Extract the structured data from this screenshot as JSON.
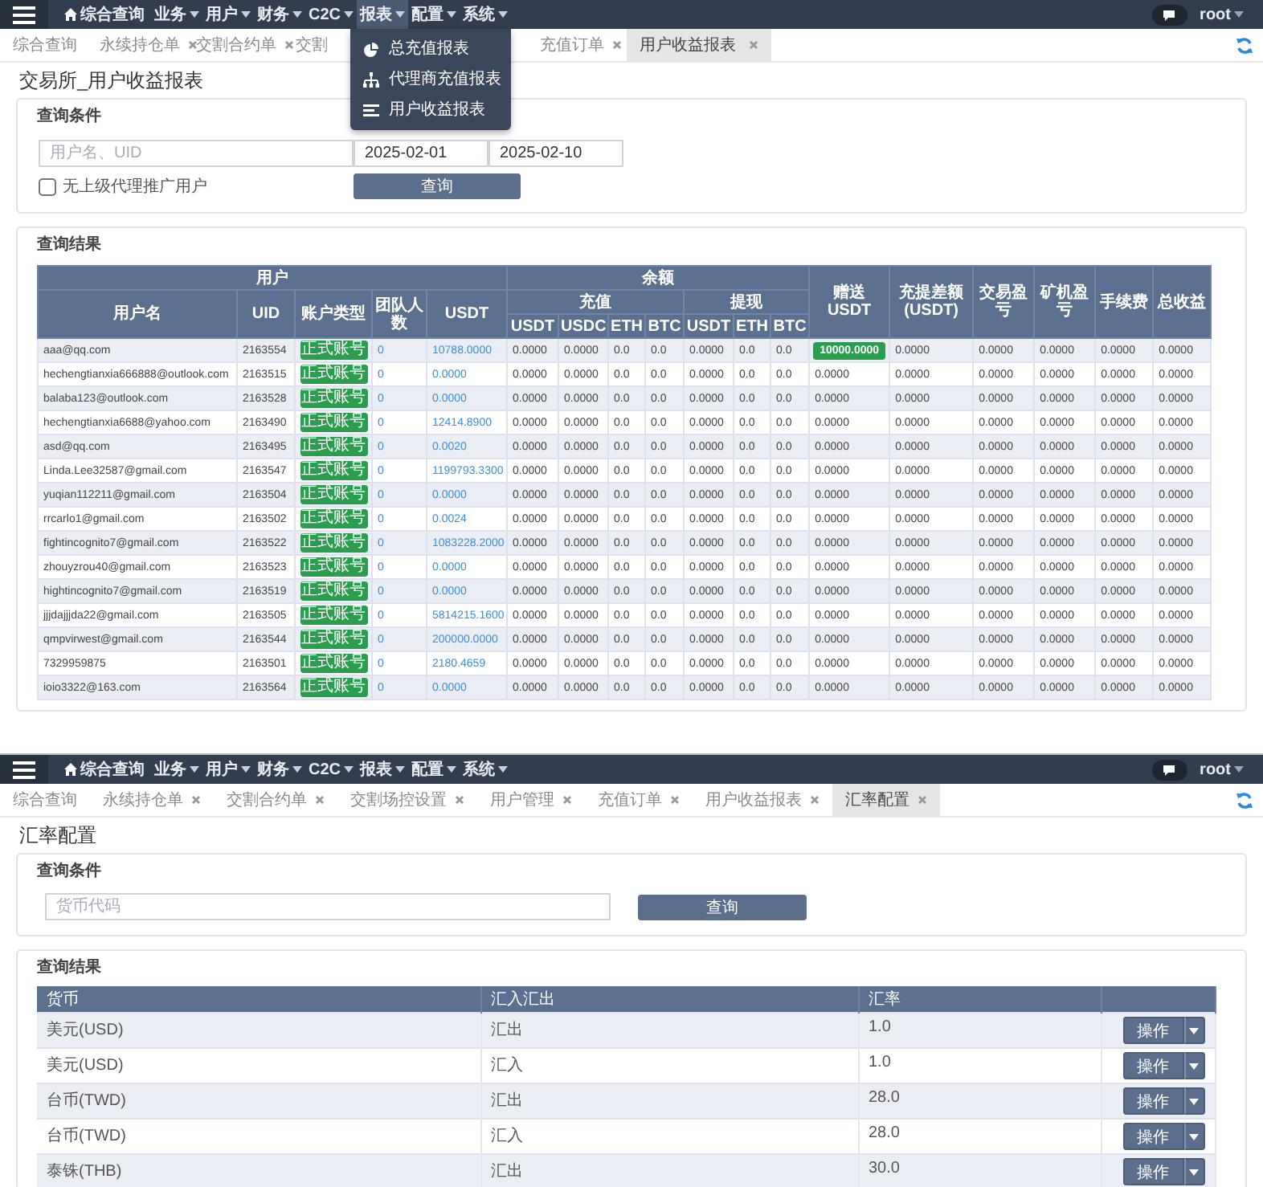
{
  "report_screen": {
    "navbar": {
      "home": "综合查询",
      "menus": [
        {
          "label": "业务",
          "open": false
        },
        {
          "label": "用户",
          "open": false
        },
        {
          "label": "财务",
          "open": false
        },
        {
          "label": "C2C",
          "open": false
        },
        {
          "label": "报表",
          "open": true
        },
        {
          "label": "配置",
          "open": false
        },
        {
          "label": "系统",
          "open": false
        }
      ],
      "user": "root"
    },
    "dropdown": [
      {
        "label": "总充值报表"
      },
      {
        "label": "代理商充值报表"
      },
      {
        "label": "用户收益报表"
      }
    ],
    "tabs": [
      {
        "label": "综合查询",
        "selected": false,
        "closable": false
      },
      {
        "label": "永续持仓单",
        "selected": false,
        "closable": true
      },
      {
        "label": "交割合约单",
        "selected": false,
        "closable": true
      },
      {
        "label": "交割",
        "selected": false,
        "closable": false
      },
      {
        "label": "充值订单",
        "selected": false,
        "closable": true
      },
      {
        "label": "用户收益报表",
        "selected": true,
        "closable": true
      }
    ],
    "title": "交易所_用户收益报表",
    "query": {
      "title": "查询条件",
      "user_placeholder": "用户名、UID",
      "date_from": "2025-02-01",
      "date_to": "2025-02-10",
      "checkbox": {
        "label": "无上级代理推广用户",
        "checked": false
      },
      "button": "查询"
    },
    "results": {
      "title": "查询结果",
      "groups": {
        "user": "用户",
        "balance": "余额",
        "deposit": "充值",
        "withdraw": "提现"
      },
      "columns": [
        "用户名",
        "UID",
        "账户类型",
        "团队人数",
        "USDT",
        "USDT",
        "USDC",
        "ETH",
        "BTC",
        "USDT",
        "ETH",
        "BTC",
        "赠送USDT",
        "充提差额(USDT)",
        "交易盈亏",
        "矿机盈亏",
        "手续费",
        "总收益"
      ],
      "rows": [
        {
          "gift_badge": true,
          "cells": [
            "aaa@qq.com",
            "2163554",
            "正式账号",
            "0",
            "10788.0000",
            "0.0000",
            "0.0000",
            "0.0",
            "0.0",
            "0.0000",
            "0.0",
            "0.0",
            "10000.0000",
            "0.0000",
            "0.0000",
            "0.0000",
            "0.0000",
            "0.0000"
          ]
        },
        {
          "gift_badge": false,
          "cells": [
            "hechengtianxia666888@outlook.com",
            "2163515",
            "正式账号",
            "0",
            "0.0000",
            "0.0000",
            "0.0000",
            "0.0",
            "0.0",
            "0.0000",
            "0.0",
            "0.0",
            "0.0000",
            "0.0000",
            "0.0000",
            "0.0000",
            "0.0000",
            "0.0000"
          ]
        },
        {
          "gift_badge": false,
          "cells": [
            "balaba123@outlook.com",
            "2163528",
            "正式账号",
            "0",
            "0.0000",
            "0.0000",
            "0.0000",
            "0.0",
            "0.0",
            "0.0000",
            "0.0",
            "0.0",
            "0.0000",
            "0.0000",
            "0.0000",
            "0.0000",
            "0.0000",
            "0.0000"
          ]
        },
        {
          "gift_badge": false,
          "cells": [
            "hechengtianxia6688@yahoo.com",
            "2163490",
            "正式账号",
            "0",
            "12414.8900",
            "0.0000",
            "0.0000",
            "0.0",
            "0.0",
            "0.0000",
            "0.0",
            "0.0",
            "0.0000",
            "0.0000",
            "0.0000",
            "0.0000",
            "0.0000",
            "0.0000"
          ]
        },
        {
          "gift_badge": false,
          "cells": [
            "asd@qq.com",
            "2163495",
            "正式账号",
            "0",
            "0.0020",
            "0.0000",
            "0.0000",
            "0.0",
            "0.0",
            "0.0000",
            "0.0",
            "0.0",
            "0.0000",
            "0.0000",
            "0.0000",
            "0.0000",
            "0.0000",
            "0.0000"
          ]
        },
        {
          "gift_badge": false,
          "cells": [
            "Linda.Lee32587@gmail.com",
            "2163547",
            "正式账号",
            "0",
            "1199793.3300",
            "0.0000",
            "0.0000",
            "0.0",
            "0.0",
            "0.0000",
            "0.0",
            "0.0",
            "0.0000",
            "0.0000",
            "0.0000",
            "0.0000",
            "0.0000",
            "0.0000"
          ]
        },
        {
          "gift_badge": false,
          "cells": [
            "yuqian112211@gmail.com",
            "2163504",
            "正式账号",
            "0",
            "0.0000",
            "0.0000",
            "0.0000",
            "0.0",
            "0.0",
            "0.0000",
            "0.0",
            "0.0",
            "0.0000",
            "0.0000",
            "0.0000",
            "0.0000",
            "0.0000",
            "0.0000"
          ]
        },
        {
          "gift_badge": false,
          "cells": [
            "rrcarlo1@gmail.com",
            "2163502",
            "正式账号",
            "0",
            "0.0024",
            "0.0000",
            "0.0000",
            "0.0",
            "0.0",
            "0.0000",
            "0.0",
            "0.0",
            "0.0000",
            "0.0000",
            "0.0000",
            "0.0000",
            "0.0000",
            "0.0000"
          ]
        },
        {
          "gift_badge": false,
          "cells": [
            "fightincognito7@gmail.com",
            "2163522",
            "正式账号",
            "0",
            "1083228.2000",
            "0.0000",
            "0.0000",
            "0.0",
            "0.0",
            "0.0000",
            "0.0",
            "0.0",
            "0.0000",
            "0.0000",
            "0.0000",
            "0.0000",
            "0.0000",
            "0.0000"
          ]
        },
        {
          "gift_badge": false,
          "cells": [
            "zhouyzrou40@gmail.com",
            "2163523",
            "正式账号",
            "0",
            "0.0000",
            "0.0000",
            "0.0000",
            "0.0",
            "0.0",
            "0.0000",
            "0.0",
            "0.0",
            "0.0000",
            "0.0000",
            "0.0000",
            "0.0000",
            "0.0000",
            "0.0000"
          ]
        },
        {
          "gift_badge": false,
          "cells": [
            "hightincognito7@gmail.com",
            "2163519",
            "正式账号",
            "0",
            "0.0000",
            "0.0000",
            "0.0000",
            "0.0",
            "0.0",
            "0.0000",
            "0.0",
            "0.0",
            "0.0000",
            "0.0000",
            "0.0000",
            "0.0000",
            "0.0000",
            "0.0000"
          ]
        },
        {
          "gift_badge": false,
          "cells": [
            "jjjdajjjda22@gmail.com",
            "2163505",
            "正式账号",
            "0",
            "5814215.1600",
            "0.0000",
            "0.0000",
            "0.0",
            "0.0",
            "0.0000",
            "0.0",
            "0.0",
            "0.0000",
            "0.0000",
            "0.0000",
            "0.0000",
            "0.0000",
            "0.0000"
          ]
        },
        {
          "gift_badge": false,
          "cells": [
            "qmpvirwest@gmail.com",
            "2163544",
            "正式账号",
            "0",
            "200000.0000",
            "0.0000",
            "0.0000",
            "0.0",
            "0.0",
            "0.0000",
            "0.0",
            "0.0",
            "0.0000",
            "0.0000",
            "0.0000",
            "0.0000",
            "0.0000",
            "0.0000"
          ]
        },
        {
          "gift_badge": false,
          "cells": [
            "7329959875",
            "2163501",
            "正式账号",
            "0",
            "2180.4659",
            "0.0000",
            "0.0000",
            "0.0",
            "0.0",
            "0.0000",
            "0.0",
            "0.0",
            "0.0000",
            "0.0000",
            "0.0000",
            "0.0000",
            "0.0000",
            "0.0000"
          ]
        },
        {
          "gift_badge": false,
          "cells": [
            "ioio3322@163.com",
            "2163564",
            "正式账号",
            "0",
            "0.0000",
            "0.0000",
            "0.0000",
            "0.0",
            "0.0",
            "0.0000",
            "0.0",
            "0.0",
            "0.0000",
            "0.0000",
            "0.0000",
            "0.0000",
            "0.0000",
            "0.0000"
          ]
        }
      ]
    }
  },
  "rate_screen": {
    "navbar": {
      "home": "综合查询",
      "menus": [
        {
          "label": "业务",
          "open": false
        },
        {
          "label": "用户",
          "open": false
        },
        {
          "label": "财务",
          "open": false
        },
        {
          "label": "C2C",
          "open": false
        },
        {
          "label": "报表",
          "open": false
        },
        {
          "label": "配置",
          "open": false
        },
        {
          "label": "系统",
          "open": false
        }
      ],
      "user": "root"
    },
    "tabs": [
      {
        "label": "综合查询",
        "selected": false,
        "closable": false
      },
      {
        "label": "永续持仓单",
        "selected": false,
        "closable": true
      },
      {
        "label": "交割合约单",
        "selected": false,
        "closable": true
      },
      {
        "label": "交割场控设置",
        "selected": false,
        "closable": true
      },
      {
        "label": "用户管理",
        "selected": false,
        "closable": true
      },
      {
        "label": "充值订单",
        "selected": false,
        "closable": true
      },
      {
        "label": "用户收益报表",
        "selected": false,
        "closable": true
      },
      {
        "label": "汇率配置",
        "selected": true,
        "closable": true
      }
    ],
    "title": "汇率配置",
    "query": {
      "title": "查询条件",
      "placeholder": "货币代码",
      "button": "查询"
    },
    "results": {
      "title": "查询结果",
      "columns": [
        "货币",
        "汇入汇出",
        "汇率"
      ],
      "rows": [
        {
          "currency": "美元(USD)",
          "direction": "汇出",
          "rate": "1.0",
          "action": "操作"
        },
        {
          "currency": "美元(USD)",
          "direction": "汇入",
          "rate": "1.0",
          "action": "操作"
        },
        {
          "currency": "台币(TWD)",
          "direction": "汇出",
          "rate": "28.0",
          "action": "操作"
        },
        {
          "currency": "台币(TWD)",
          "direction": "汇入",
          "rate": "28.0",
          "action": "操作"
        },
        {
          "currency": "泰铢(THB)",
          "direction": "汇出",
          "rate": "30.0",
          "action": "操作"
        }
      ]
    }
  }
}
